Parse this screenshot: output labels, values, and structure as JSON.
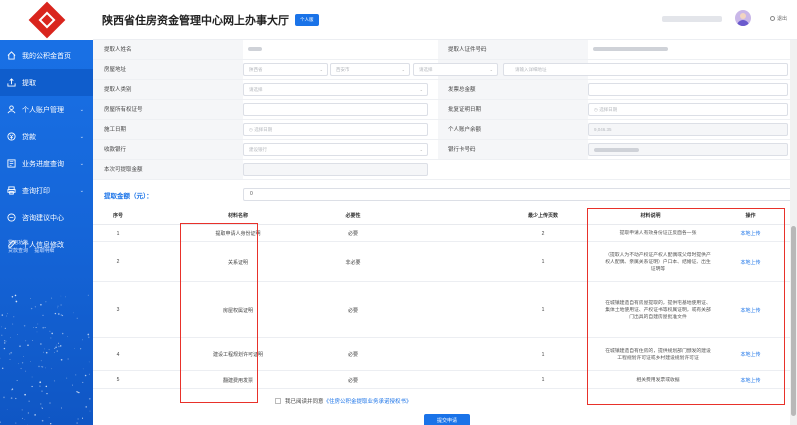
{
  "header": {
    "title": "陕西省住房资金管理中心网上办事大厅",
    "badge": "个人版",
    "logout": "退出"
  },
  "sidebar": {
    "items": [
      {
        "label": "我的公积金首页",
        "icon": "home-icon",
        "chevron": false
      },
      {
        "label": "提取",
        "icon": "upload-icon",
        "chevron": false,
        "active": true
      },
      {
        "label": "个人账户管理",
        "icon": "user-icon",
        "chevron": true
      },
      {
        "label": "贷款",
        "icon": "loan-icon",
        "chevron": true
      },
      {
        "label": "业务进度查询",
        "icon": "progress-icon",
        "chevron": true
      },
      {
        "label": "查询打印",
        "icon": "print-icon",
        "chevron": true
      },
      {
        "label": "咨询建议中心",
        "icon": "chat-icon",
        "chevron": false
      },
      {
        "label": "个人信息修改",
        "icon": "edit-icon",
        "chevron": false
      }
    ],
    "common_title": "常用功能",
    "common_links": [
      "贷款查询",
      "提取明细"
    ]
  },
  "form": {
    "rows": [
      {
        "label": "提取人姓名",
        "label2": "提取人证件号码"
      },
      {
        "label": "房屋地址",
        "label2": "",
        "placeholders": [
          "陕西省",
          "西安市",
          "请选择",
          "请输入详细地址"
        ]
      },
      {
        "label": "提取人类别",
        "label2": "发票总金额",
        "placeholder": "请选择"
      },
      {
        "label": "房屋所有权证号",
        "label2": "批复证明日期",
        "placeholder2": "选择日期"
      },
      {
        "label": "施工日期",
        "label2": "个人账户余额",
        "placeholder": "选择日期",
        "value2": "9,046.35"
      },
      {
        "label": "收款银行",
        "label2": "银行卡号码",
        "placeholder": "建设银行"
      },
      {
        "label": "本次可提取金额",
        "label2": ""
      }
    ],
    "amount_label": "提取金额（元）：",
    "amount_value": "0"
  },
  "table": {
    "headers": [
      "序号",
      "材料名称",
      "必要性",
      "最少上传页数",
      "材料说明",
      "操作"
    ],
    "rows": [
      {
        "no": "1",
        "name": "提取申请人身份证明",
        "need": "必要",
        "pages": "2",
        "desc": "提取申请人有效身份证正反面各一张",
        "op": "本地上传"
      },
      {
        "no": "2",
        "name": "关系证明",
        "need": "非必要",
        "pages": "1",
        "desc": "（提取人为不动产权证产权人配偶或父母时提供产权人配偶、亲属关系证明）户口本、结婚证、出生证明等",
        "op": "本地上传"
      },
      {
        "no": "3",
        "name": "房屋权属证明",
        "need": "必要",
        "pages": "1",
        "desc": "在城镇建造自有房屋提取的，提供宅基地使用证、集体土地使用证、产权证书等权属证明，或有关部门出具的自建房屋批准文件",
        "op": "本地上传"
      },
      {
        "no": "4",
        "name": "建设工程规划许可证明",
        "need": "必要",
        "pages": "1",
        "desc": "在城镇建造自有住房的，提供规划部门颁发的建设工程规划许可证或乡村建设规划许可证",
        "op": "本地上传"
      },
      {
        "no": "5",
        "name": "翻建费用发票",
        "need": "必要",
        "pages": "1",
        "desc": "相关费用发票或收据",
        "op": "本地上传"
      }
    ]
  },
  "agree": {
    "prefix": "我已阅读并同意",
    "link": "《住房公积金提取业务承诺授权书》"
  },
  "submit_label": "提交申请",
  "colors": {
    "primary": "#1a73e8",
    "highlight": "#e8312a"
  }
}
